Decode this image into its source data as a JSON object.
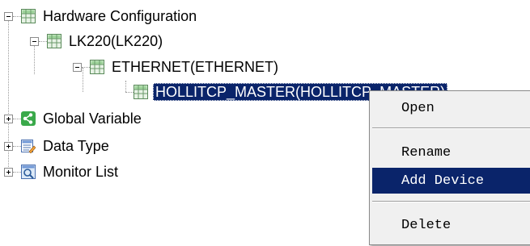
{
  "tree": {
    "hardware": {
      "label": "Hardware Configuration",
      "icon": "grid-module-icon"
    },
    "lk220": {
      "label": "LK220(LK220)",
      "icon": "grid-module-icon"
    },
    "ethernet": {
      "label": "ETHERNET(ETHERNET)",
      "icon": "grid-module-icon"
    },
    "master": {
      "label": "HOLLITCP_MASTER(HOLLITCP_MASTER)",
      "icon": "grid-module-icon"
    },
    "global": {
      "label": "Global Variable",
      "icon": "share-icon"
    },
    "datatype": {
      "label": "Data Type",
      "icon": "data-type-icon"
    },
    "monitor": {
      "label": "Monitor List",
      "icon": "monitor-icon"
    }
  },
  "context_menu": {
    "open": "Open",
    "rename": "Rename",
    "add_device": "Add Device",
    "delete": "Delete"
  },
  "colors": {
    "selection": "#0a246a",
    "menu_bg": "#f0f0f0",
    "icon_green": "#3aa94a"
  }
}
